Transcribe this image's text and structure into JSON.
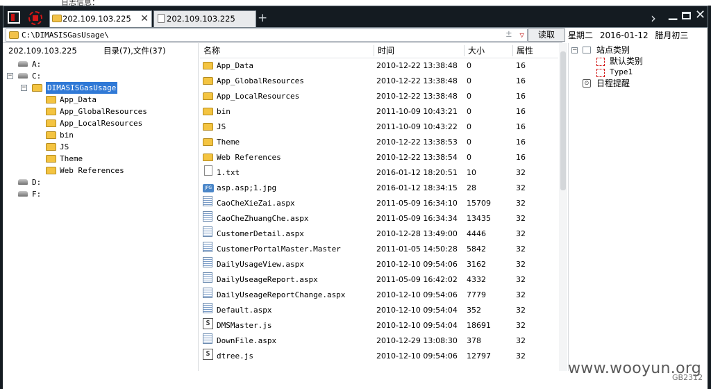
{
  "background_fragment": "日志信息：",
  "tabs": [
    {
      "label": "202.109.103.225",
      "active": true,
      "close": "✕"
    },
    {
      "label": "202.109.103.225",
      "active": false
    }
  ],
  "tab_add": "+",
  "address": {
    "path": "C:\\DIMASISGasUsage\\",
    "read_button": "读取"
  },
  "calendar": {
    "weekday": "星期二",
    "date": "2016-01-12",
    "lunar": "腊月初三"
  },
  "left_header": {
    "host": "202.109.103.225",
    "counts": "目录(7),文件(37)"
  },
  "tree": [
    {
      "label": "A:",
      "kind": "drive",
      "indent": 0
    },
    {
      "label": "C:",
      "kind": "drive",
      "indent": 0,
      "expander": "⊟"
    },
    {
      "label": "DIMASISGasUsage",
      "kind": "folder",
      "indent": 1,
      "expander": "⊟",
      "selected": true
    },
    {
      "label": "App_Data",
      "kind": "folder",
      "indent": 2
    },
    {
      "label": "App_GlobalResources",
      "kind": "folder",
      "indent": 2
    },
    {
      "label": "App_LocalResources",
      "kind": "folder",
      "indent": 2
    },
    {
      "label": "bin",
      "kind": "folder",
      "indent": 2
    },
    {
      "label": "JS",
      "kind": "folder",
      "indent": 2
    },
    {
      "label": "Theme",
      "kind": "folder",
      "indent": 2
    },
    {
      "label": "Web References",
      "kind": "folder",
      "indent": 2
    },
    {
      "label": "D:",
      "kind": "drive",
      "indent": 0
    },
    {
      "label": "F:",
      "kind": "drive",
      "indent": 0
    }
  ],
  "columns": {
    "name": "名称",
    "time": "时间",
    "size": "大小",
    "attr": "属性"
  },
  "files": [
    {
      "icon": "folder",
      "name": "App_Data",
      "time": "2010-12-22 13:38:48",
      "size": "0",
      "attr": "16"
    },
    {
      "icon": "folder",
      "name": "App_GlobalResources",
      "time": "2010-12-22 13:38:48",
      "size": "0",
      "attr": "16"
    },
    {
      "icon": "folder",
      "name": "App_LocalResources",
      "time": "2010-12-22 13:38:48",
      "size": "0",
      "attr": "16"
    },
    {
      "icon": "folder",
      "name": "bin",
      "time": "2011-10-09 10:43:21",
      "size": "0",
      "attr": "16"
    },
    {
      "icon": "folder",
      "name": "JS",
      "time": "2011-10-09 10:43:22",
      "size": "0",
      "attr": "16"
    },
    {
      "icon": "folder",
      "name": "Theme",
      "time": "2010-12-22 13:38:53",
      "size": "0",
      "attr": "16"
    },
    {
      "icon": "folder",
      "name": "Web References",
      "time": "2010-12-22 13:38:54",
      "size": "0",
      "attr": "16"
    },
    {
      "icon": "txt",
      "name": "1.txt",
      "time": "2016-01-12 18:20:51",
      "size": "10",
      "attr": "32"
    },
    {
      "icon": "jpg",
      "name": "asp.asp;1.jpg",
      "time": "2016-01-12 18:34:15",
      "size": "28",
      "attr": "32"
    },
    {
      "icon": "aspx",
      "name": "CaoCheXieZai.aspx",
      "time": "2011-05-09 16:34:10",
      "size": "15709",
      "attr": "32"
    },
    {
      "icon": "aspx",
      "name": "CaoCheZhuangChe.aspx",
      "time": "2011-05-09 16:34:34",
      "size": "13435",
      "attr": "32"
    },
    {
      "icon": "aspx",
      "name": "CustomerDetail.aspx",
      "time": "2010-12-28 13:49:00",
      "size": "4446",
      "attr": "32"
    },
    {
      "icon": "aspx",
      "name": "CustomerPortalMaster.Master",
      "time": "2011-01-05 14:50:28",
      "size": "5842",
      "attr": "32"
    },
    {
      "icon": "aspx",
      "name": "DailyUsageView.aspx",
      "time": "2010-12-10 09:54:06",
      "size": "3162",
      "attr": "32"
    },
    {
      "icon": "aspx",
      "name": "DailyUseageReport.aspx",
      "time": "2011-05-09 16:42:02",
      "size": "4332",
      "attr": "32"
    },
    {
      "icon": "aspx",
      "name": "DailyUseageReportChange.aspx",
      "time": "2010-12-10 09:54:06",
      "size": "7779",
      "attr": "32"
    },
    {
      "icon": "aspx",
      "name": "Default.aspx",
      "time": "2010-12-10 09:54:04",
      "size": "352",
      "attr": "32"
    },
    {
      "icon": "js",
      "name": "DMSMaster.js",
      "time": "2010-12-10 09:54:04",
      "size": "18691",
      "attr": "32"
    },
    {
      "icon": "aspx",
      "name": "DownFile.aspx",
      "time": "2010-12-29 13:08:30",
      "size": "378",
      "attr": "32"
    },
    {
      "icon": "js",
      "name": "dtree.js",
      "time": "2010-12-10 09:54:06",
      "size": "12797",
      "attr": "32"
    }
  ],
  "site_panel": {
    "root": "站点类别",
    "children": [
      "默认类别",
      "Type1"
    ],
    "schedule": "日程提醒"
  },
  "watermark": "www.wooyun.org",
  "watermark_small": "GB2312"
}
